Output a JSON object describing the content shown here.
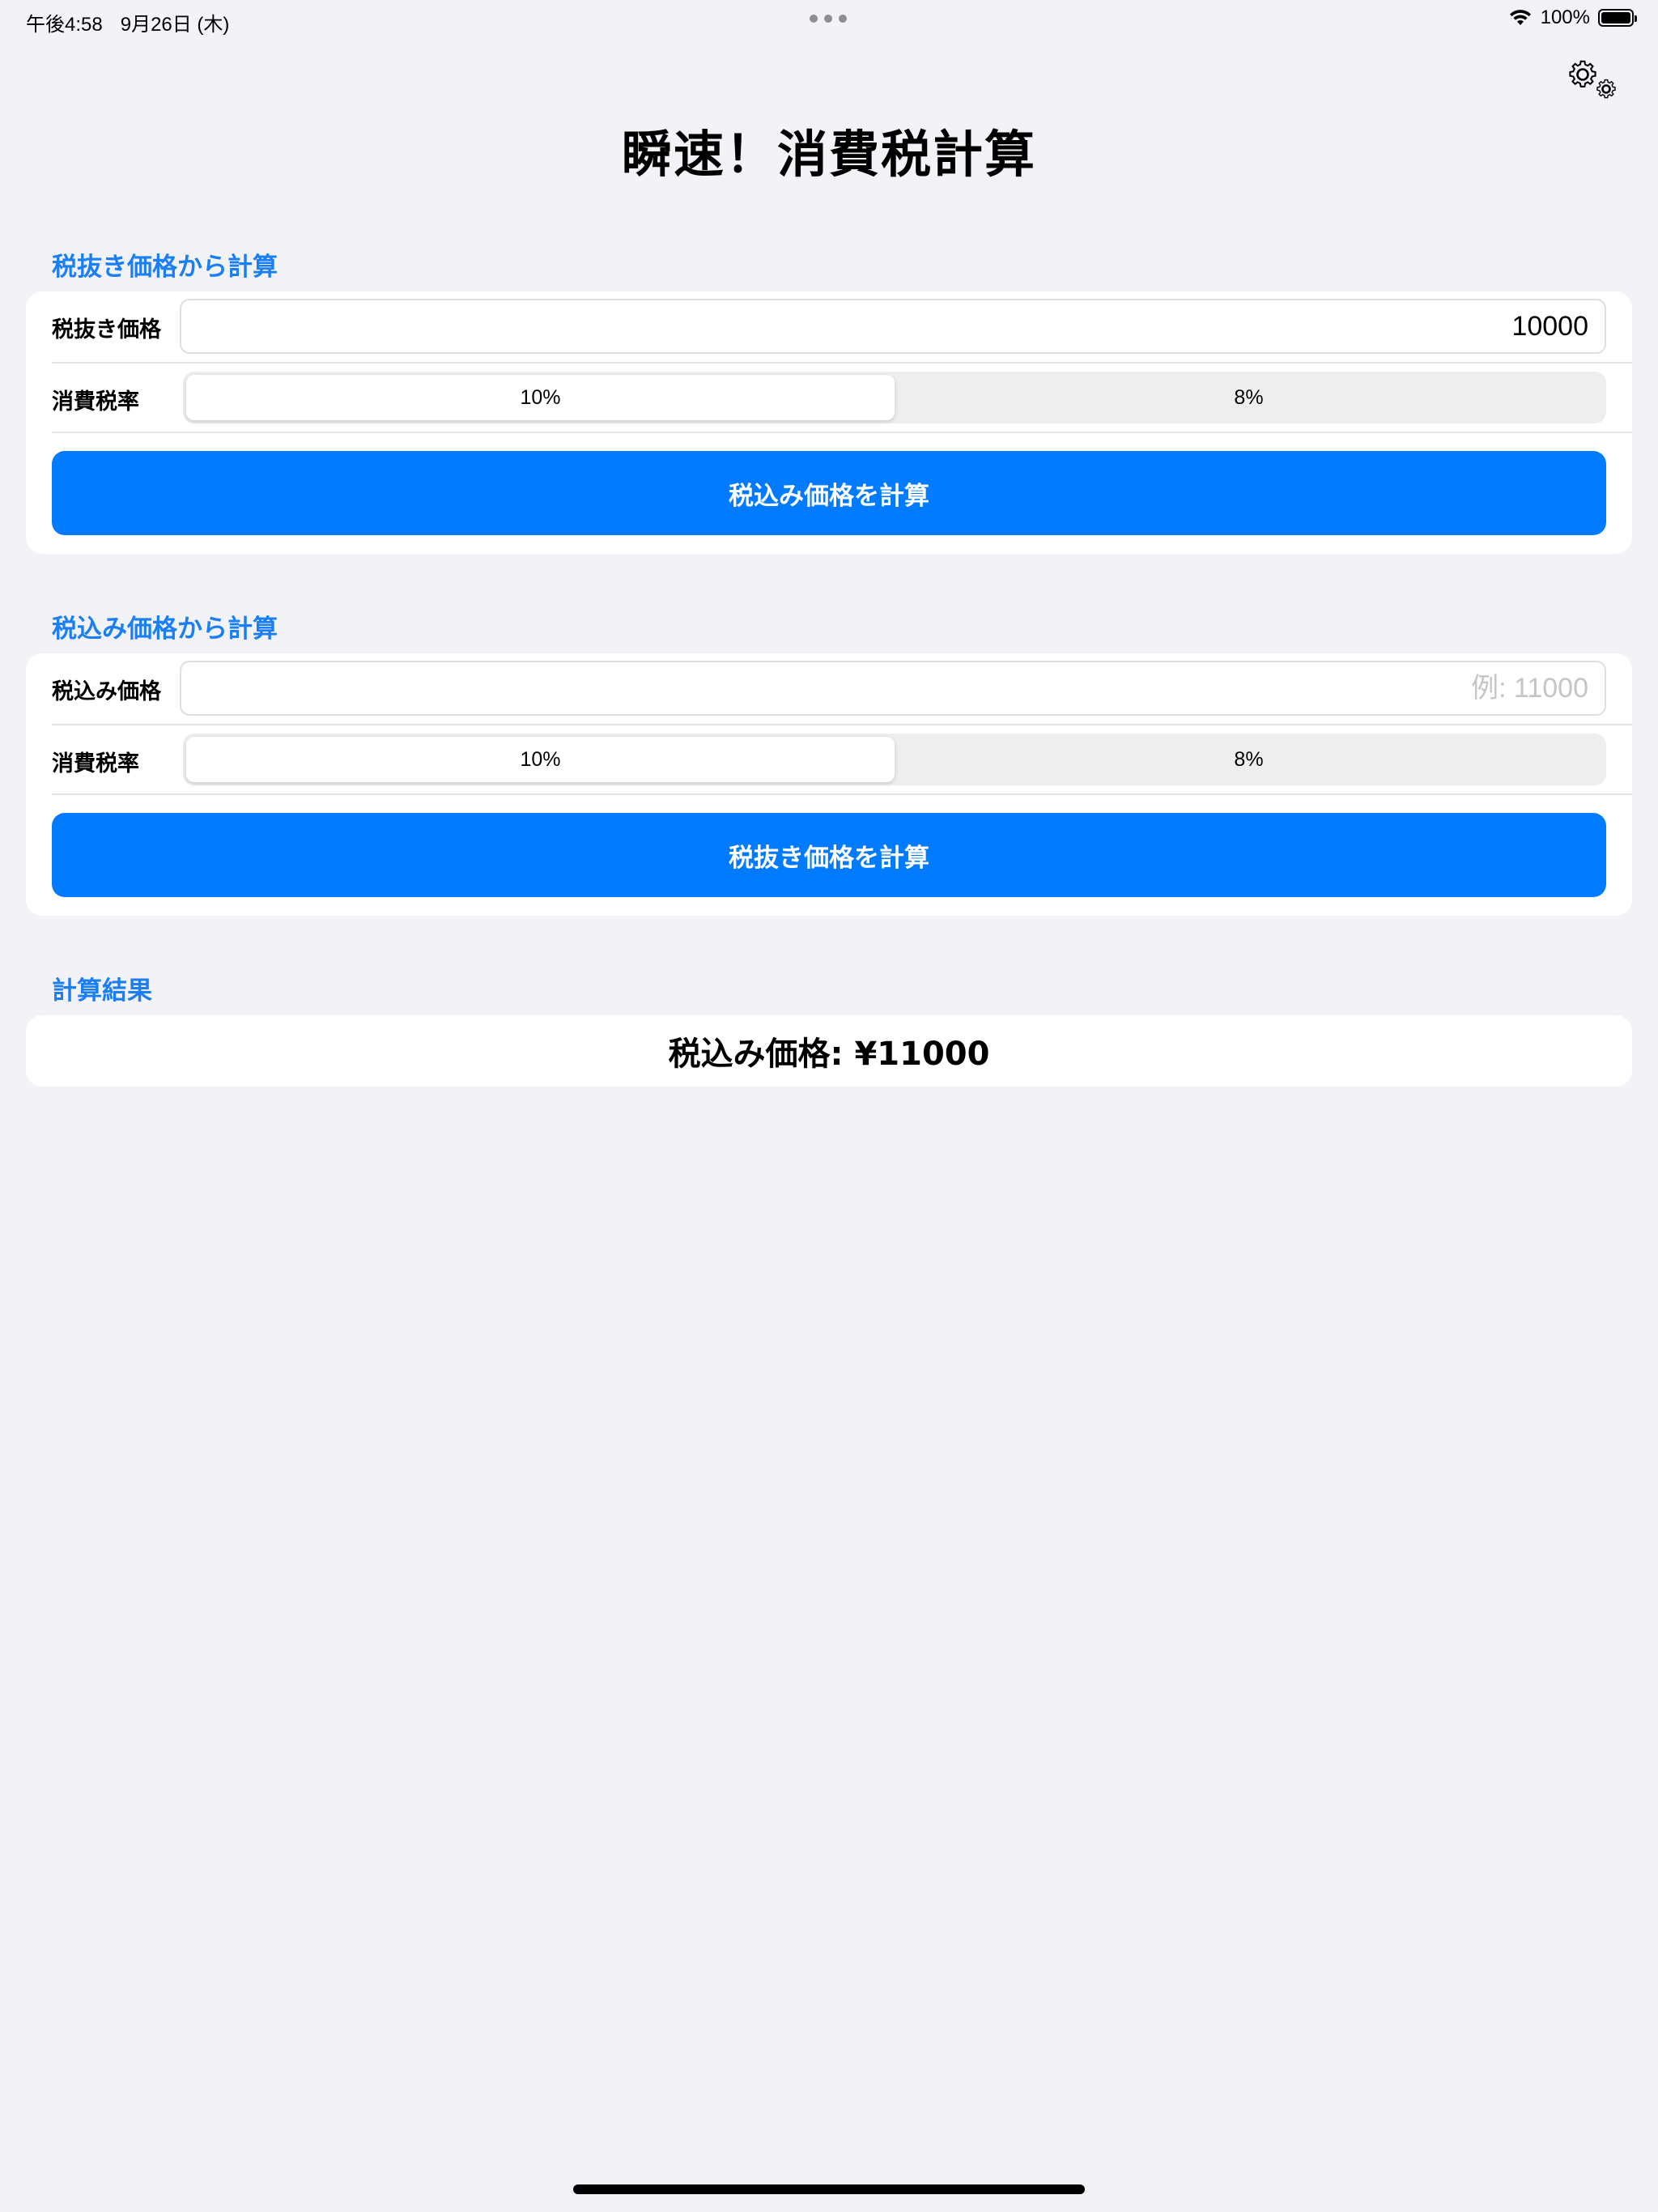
{
  "status_bar": {
    "time": "午後4:58",
    "date": "9月26日 (木)",
    "battery_percent": "100%",
    "battery_level": 1.0,
    "icons": [
      "wifi-icon",
      "battery-icon"
    ]
  },
  "header": {
    "title": "瞬速！消費税計算",
    "settings_icon": "gear-icon"
  },
  "section_exclusive": {
    "header": "税抜き価格から計算",
    "price_label": "税抜き価格",
    "price_value": "10000",
    "price_placeholder": "",
    "tax_rate_label": "消費税率",
    "tax_options": [
      "10%",
      "8%"
    ],
    "selected_option": "10%",
    "button_label": "税込み価格を計算"
  },
  "section_inclusive": {
    "header": "税込み価格から計算",
    "price_label": "税込み価格",
    "price_value": "",
    "price_placeholder": "例: 11000",
    "tax_rate_label": "消費税率",
    "tax_options": [
      "10%",
      "8%"
    ],
    "selected_option": "10%",
    "button_label": "税抜き価格を計算"
  },
  "result": {
    "header": "計算結果",
    "text": "税込み価格: ¥11000"
  },
  "colors": {
    "accent": "#007aff",
    "section_header": "#1a7ef5",
    "background": "#f2f2f7",
    "card": "#ffffff"
  }
}
